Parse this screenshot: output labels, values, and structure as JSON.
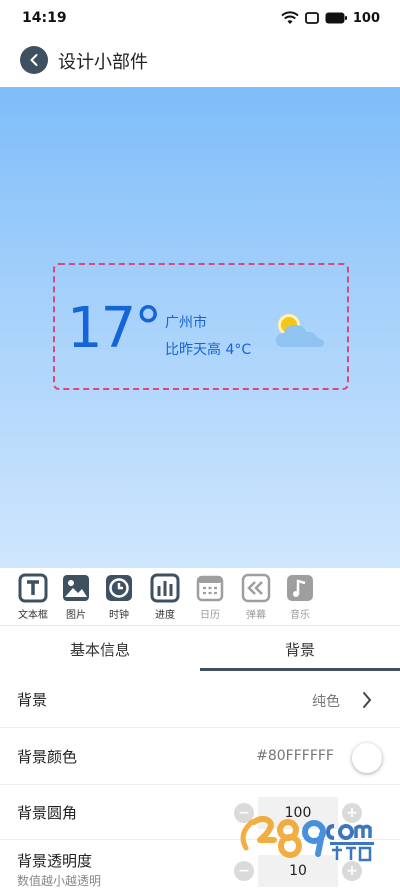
{
  "status": {
    "time": "14:19",
    "battery": "100"
  },
  "header": {
    "title": "设计小部件"
  },
  "widget": {
    "temperature": "17°",
    "city": "广州市",
    "comparison": "比昨天高 4°C"
  },
  "toolbar": {
    "items": [
      {
        "label": "文本框",
        "icon": "text-icon",
        "enabled": true
      },
      {
        "label": "图片",
        "icon": "image-icon",
        "enabled": true
      },
      {
        "label": "时钟",
        "icon": "clock-icon",
        "enabled": true
      },
      {
        "label": "进度",
        "icon": "progress-icon",
        "enabled": true
      },
      {
        "label": "日历",
        "icon": "calendar-icon",
        "enabled": false
      },
      {
        "label": "弹幕",
        "icon": "danmaku-icon",
        "enabled": false
      },
      {
        "label": "音乐",
        "icon": "music-icon",
        "enabled": false
      }
    ]
  },
  "tabs": {
    "basic": "基本信息",
    "background": "背景",
    "active": "background"
  },
  "settings": {
    "background": {
      "label": "背景",
      "value": "纯色"
    },
    "background_color": {
      "label": "背景颜色",
      "value": "#80FFFFFF"
    },
    "corner_radius": {
      "label": "背景圆角",
      "value": "100"
    },
    "opacity": {
      "label": "背景透明度",
      "hint": "数值越小越透明",
      "value": "10"
    }
  },
  "watermark": {
    "text": "289手游网",
    "domain": "com"
  },
  "colors": {
    "accent": "#3f5160",
    "weather_text": "#1565d8",
    "dashed_border": "#e0457a"
  }
}
